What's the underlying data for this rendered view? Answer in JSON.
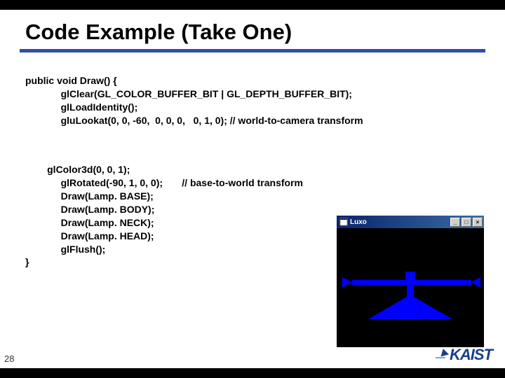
{
  "title": "Code Example (Take One)",
  "code": {
    "sig": "public void Draw() {",
    "l1": "glClear(GL_COLOR_BUFFER_BIT | GL_DEPTH_BUFFER_BIT);",
    "l2": "glLoadIdentity();",
    "l3": "gluLookat(0, 0, -60,  0, 0, 0,   0, 1, 0); // world-to-camera transform",
    "b1": "glColor3d(0, 0, 1);",
    "b2": "glRotated(-90, 1, 0, 0);",
    "b2c": "// base-to-world transform",
    "b3": "Draw(Lamp. BASE);",
    "b4": "Draw(Lamp. BODY);",
    "b5": "Draw(Lamp. NECK);",
    "b6": "Draw(Lamp. HEAD);",
    "b7": "glFlush();",
    "close": "}"
  },
  "window": {
    "title": "Luxo",
    "min": "_",
    "max": "□",
    "close": "×"
  },
  "page": "28",
  "logo": "KAIST"
}
